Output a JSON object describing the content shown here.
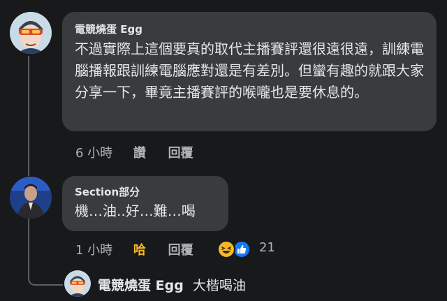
{
  "comments": [
    {
      "author": "電競燒蛋 Egg",
      "text": "不過實際上這個要真的取代主播賽評還很遠很遠，訓練電腦播報跟訓練電腦應對還是有差別。但蠻有趣的就跟大家分享一下，畢竟主播賽評的喉嚨也是要休息的。",
      "time": "6 小時",
      "like_label": "讚",
      "reply_label": "回覆"
    },
    {
      "author": "Section部分",
      "text": "機…油..好…難…喝",
      "time": "1 小時",
      "reaction_label": "哈",
      "reply_label": "回覆",
      "reaction_count": "21",
      "reaction_icons": [
        "haha-emoji-icon",
        "like-thumb-icon"
      ]
    }
  ],
  "reply_preview": {
    "author": "電競燒蛋 Egg",
    "text": "大楷喝油"
  },
  "colors": {
    "background": "#18191a",
    "bubble": "#3a3b3c",
    "text": "#e4e6eb",
    "meta": "#b0b3b8",
    "haha": "#f7b928",
    "like": "#1877f2"
  }
}
